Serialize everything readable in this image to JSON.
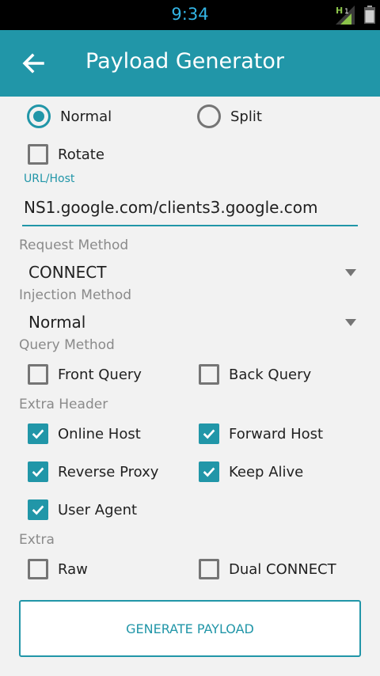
{
  "status_bar": {
    "time": "9:34"
  },
  "app_bar": {
    "title": "Payload Generator"
  },
  "mode": {
    "options": [
      {
        "label": "Normal",
        "selected": true
      },
      {
        "label": "Split",
        "selected": false
      }
    ]
  },
  "rotate": {
    "label": "Rotate",
    "checked": false
  },
  "url_host": {
    "label": "URL/Host",
    "value": "NS1.google.com/clients3.google.com"
  },
  "request_method": {
    "label": "Request Method",
    "value": "CONNECT"
  },
  "injection_method": {
    "label": "Injection Method",
    "value": "Normal"
  },
  "query_method": {
    "label": "Query Method",
    "options": [
      {
        "label": "Front Query",
        "checked": false
      },
      {
        "label": "Back Query",
        "checked": false
      }
    ]
  },
  "extra_header": {
    "label": "Extra Header",
    "options": [
      {
        "label": "Online Host",
        "checked": true
      },
      {
        "label": "Forward Host",
        "checked": true
      },
      {
        "label": "Reverse Proxy",
        "checked": true
      },
      {
        "label": "Keep Alive",
        "checked": true
      },
      {
        "label": "User Agent",
        "checked": true
      }
    ]
  },
  "extra": {
    "label": "Extra",
    "options": [
      {
        "label": "Raw",
        "checked": false
      },
      {
        "label": "Dual CONNECT",
        "checked": false
      }
    ]
  },
  "generate_button": {
    "label": "GENERATE PAYLOAD"
  },
  "colors": {
    "accent": "#2196a8",
    "status_time": "#33b5e5",
    "section_label": "#8a8a8a",
    "background": "#f2f2f2"
  }
}
